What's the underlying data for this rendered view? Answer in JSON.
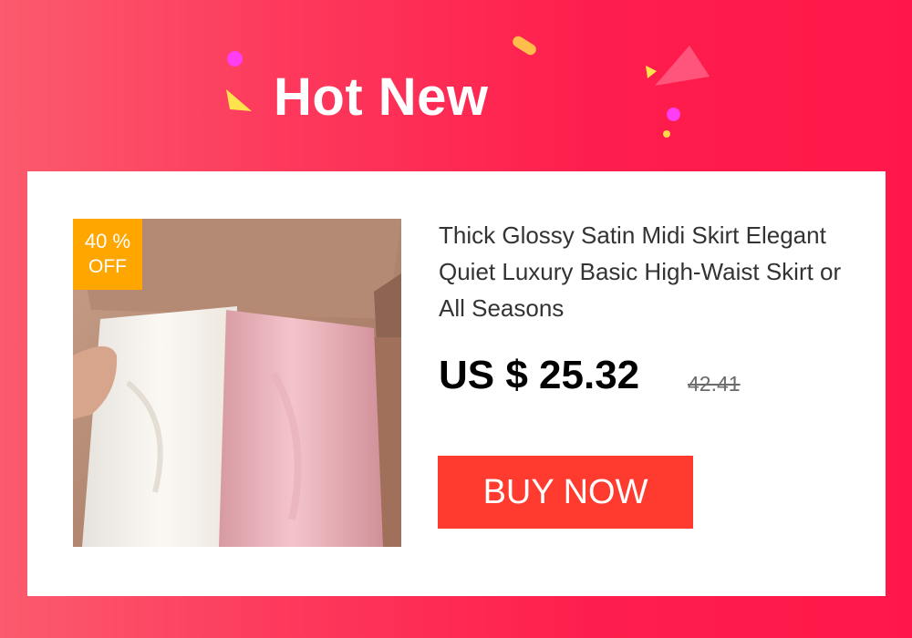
{
  "banner": {
    "title": "Hot New"
  },
  "product": {
    "image_alt": "Satin midi skirts in white and pink laid in a box",
    "discount": {
      "percent_text": "40 %",
      "off_text": "OFF"
    },
    "title": "Thick Glossy Satin Midi Skirt Elegant Quiet Luxury Basic High-Waist Skirt or All Seasons",
    "price": {
      "current": "US $ 25.32",
      "original": "42.41"
    },
    "buy_label": "BUY NOW"
  },
  "colors": {
    "background_gradient": [
      "#fb5b6e",
      "#ff1749"
    ],
    "badge": "#ffa600",
    "buy_button": "#ff3b30",
    "card": "#ffffff"
  },
  "icons": [
    "confetti-dot",
    "confetti-triangle",
    "confetti-pill"
  ]
}
